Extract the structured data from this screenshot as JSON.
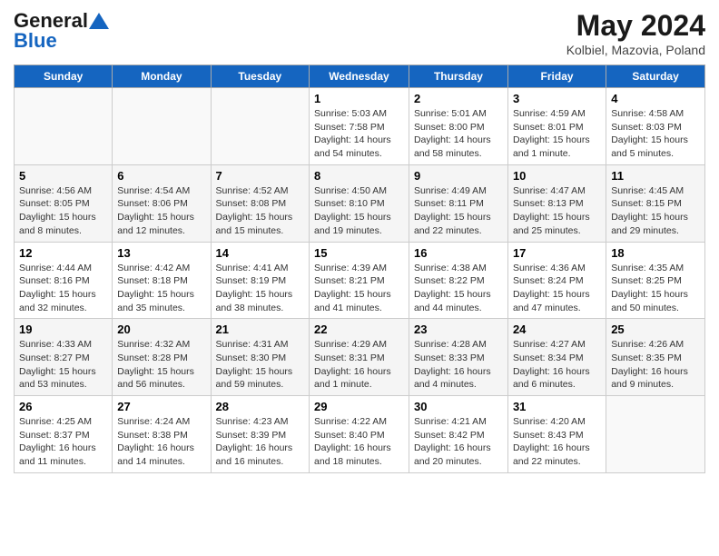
{
  "app": {
    "name": "GeneralBlue",
    "name_part1": "General",
    "name_part2": "Blue"
  },
  "title": {
    "month_year": "May 2024",
    "location": "Kolbiel, Mazovia, Poland"
  },
  "days_of_week": [
    "Sunday",
    "Monday",
    "Tuesday",
    "Wednesday",
    "Thursday",
    "Friday",
    "Saturday"
  ],
  "weeks": [
    [
      {
        "day": "",
        "info": ""
      },
      {
        "day": "",
        "info": ""
      },
      {
        "day": "",
        "info": ""
      },
      {
        "day": "1",
        "info": "Sunrise: 5:03 AM\nSunset: 7:58 PM\nDaylight: 14 hours and 54 minutes."
      },
      {
        "day": "2",
        "info": "Sunrise: 5:01 AM\nSunset: 8:00 PM\nDaylight: 14 hours and 58 minutes."
      },
      {
        "day": "3",
        "info": "Sunrise: 4:59 AM\nSunset: 8:01 PM\nDaylight: 15 hours and 1 minute."
      },
      {
        "day": "4",
        "info": "Sunrise: 4:58 AM\nSunset: 8:03 PM\nDaylight: 15 hours and 5 minutes."
      }
    ],
    [
      {
        "day": "5",
        "info": "Sunrise: 4:56 AM\nSunset: 8:05 PM\nDaylight: 15 hours and 8 minutes."
      },
      {
        "day": "6",
        "info": "Sunrise: 4:54 AM\nSunset: 8:06 PM\nDaylight: 15 hours and 12 minutes."
      },
      {
        "day": "7",
        "info": "Sunrise: 4:52 AM\nSunset: 8:08 PM\nDaylight: 15 hours and 15 minutes."
      },
      {
        "day": "8",
        "info": "Sunrise: 4:50 AM\nSunset: 8:10 PM\nDaylight: 15 hours and 19 minutes."
      },
      {
        "day": "9",
        "info": "Sunrise: 4:49 AM\nSunset: 8:11 PM\nDaylight: 15 hours and 22 minutes."
      },
      {
        "day": "10",
        "info": "Sunrise: 4:47 AM\nSunset: 8:13 PM\nDaylight: 15 hours and 25 minutes."
      },
      {
        "day": "11",
        "info": "Sunrise: 4:45 AM\nSunset: 8:15 PM\nDaylight: 15 hours and 29 minutes."
      }
    ],
    [
      {
        "day": "12",
        "info": "Sunrise: 4:44 AM\nSunset: 8:16 PM\nDaylight: 15 hours and 32 minutes."
      },
      {
        "day": "13",
        "info": "Sunrise: 4:42 AM\nSunset: 8:18 PM\nDaylight: 15 hours and 35 minutes."
      },
      {
        "day": "14",
        "info": "Sunrise: 4:41 AM\nSunset: 8:19 PM\nDaylight: 15 hours and 38 minutes."
      },
      {
        "day": "15",
        "info": "Sunrise: 4:39 AM\nSunset: 8:21 PM\nDaylight: 15 hours and 41 minutes."
      },
      {
        "day": "16",
        "info": "Sunrise: 4:38 AM\nSunset: 8:22 PM\nDaylight: 15 hours and 44 minutes."
      },
      {
        "day": "17",
        "info": "Sunrise: 4:36 AM\nSunset: 8:24 PM\nDaylight: 15 hours and 47 minutes."
      },
      {
        "day": "18",
        "info": "Sunrise: 4:35 AM\nSunset: 8:25 PM\nDaylight: 15 hours and 50 minutes."
      }
    ],
    [
      {
        "day": "19",
        "info": "Sunrise: 4:33 AM\nSunset: 8:27 PM\nDaylight: 15 hours and 53 minutes."
      },
      {
        "day": "20",
        "info": "Sunrise: 4:32 AM\nSunset: 8:28 PM\nDaylight: 15 hours and 56 minutes."
      },
      {
        "day": "21",
        "info": "Sunrise: 4:31 AM\nSunset: 8:30 PM\nDaylight: 15 hours and 59 minutes."
      },
      {
        "day": "22",
        "info": "Sunrise: 4:29 AM\nSunset: 8:31 PM\nDaylight: 16 hours and 1 minute."
      },
      {
        "day": "23",
        "info": "Sunrise: 4:28 AM\nSunset: 8:33 PM\nDaylight: 16 hours and 4 minutes."
      },
      {
        "day": "24",
        "info": "Sunrise: 4:27 AM\nSunset: 8:34 PM\nDaylight: 16 hours and 6 minutes."
      },
      {
        "day": "25",
        "info": "Sunrise: 4:26 AM\nSunset: 8:35 PM\nDaylight: 16 hours and 9 minutes."
      }
    ],
    [
      {
        "day": "26",
        "info": "Sunrise: 4:25 AM\nSunset: 8:37 PM\nDaylight: 16 hours and 11 minutes."
      },
      {
        "day": "27",
        "info": "Sunrise: 4:24 AM\nSunset: 8:38 PM\nDaylight: 16 hours and 14 minutes."
      },
      {
        "day": "28",
        "info": "Sunrise: 4:23 AM\nSunset: 8:39 PM\nDaylight: 16 hours and 16 minutes."
      },
      {
        "day": "29",
        "info": "Sunrise: 4:22 AM\nSunset: 8:40 PM\nDaylight: 16 hours and 18 minutes."
      },
      {
        "day": "30",
        "info": "Sunrise: 4:21 AM\nSunset: 8:42 PM\nDaylight: 16 hours and 20 minutes."
      },
      {
        "day": "31",
        "info": "Sunrise: 4:20 AM\nSunset: 8:43 PM\nDaylight: 16 hours and 22 minutes."
      },
      {
        "day": "",
        "info": ""
      }
    ]
  ]
}
